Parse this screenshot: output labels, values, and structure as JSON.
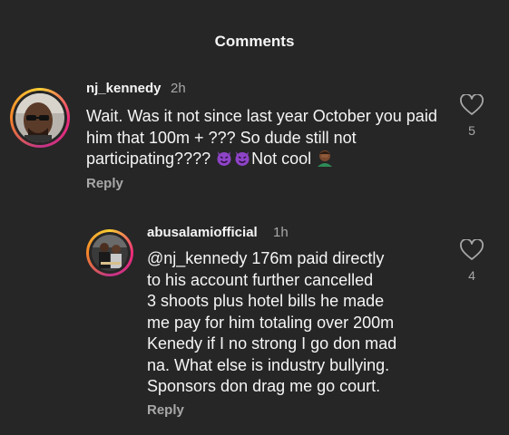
{
  "header": {
    "title": "Comments"
  },
  "comments": [
    {
      "username": "nj_kennedy",
      "time": "2h",
      "text_before_emoji": "Wait. Was it not since last year October you paid him that 100m + ??? So dude still not participating???? ",
      "text_after_emoji": "Not cool ",
      "emojis": [
        "smiling-imp-icon",
        "smiling-imp-icon",
        "person-facepalming-icon"
      ],
      "reply_label": "Reply",
      "like_count": "5"
    },
    {
      "username": "abusalamiofficial",
      "time": "1h",
      "text": "@nj_kennedy 176m paid directly\nto his account further cancelled\n3 shoots plus hotel bills he made\nme pay for him totaling over 200m\nKenedy if I no strong I go don mad\nna. What else is industry bullying.\nSponsors don drag me go court.",
      "reply_label": "Reply",
      "like_count": "4"
    }
  ],
  "colors": {
    "background": "#262626",
    "primary_text": "#f5f5f5",
    "secondary_text": "#a8a8a8",
    "imp_purple": "#8e44c7"
  }
}
